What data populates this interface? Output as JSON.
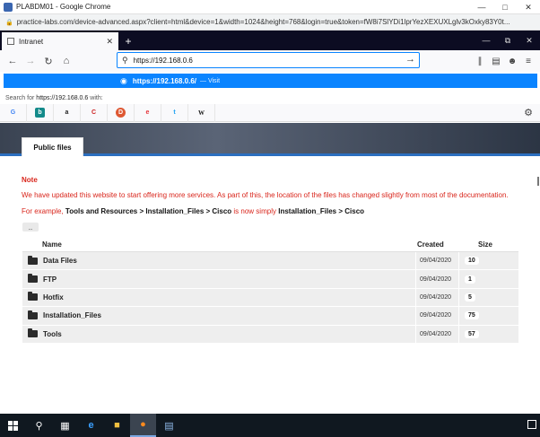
{
  "chrome": {
    "title": "PLABDM01 - Google Chrome",
    "url": "practice-labs.com/device-advanced.aspx?client=html&device=1&width=1024&height=768&login=true&token=fW8i7SlYDi1lprYezXEXUXLglv3kOxky83Y0t..."
  },
  "firefox": {
    "tab_label": "Intranet",
    "url_input": "https://192.168.0.6",
    "suggestion": {
      "url": "https://192.168.0.6/",
      "visit": "— Visit"
    },
    "search_with": {
      "prefix": "Search for",
      "query": "https://192.168.0.6",
      "suffix": "with:"
    },
    "engines": [
      {
        "name": "google-icon",
        "glyph": "G",
        "color": "#4285f4"
      },
      {
        "name": "bing-icon",
        "glyph": "b",
        "color": "#138a8a"
      },
      {
        "name": "amazon-icon",
        "glyph": "a",
        "color": "#222222"
      },
      {
        "name": "duckduckgo-icon",
        "glyph": "C",
        "color": "#cc2222"
      },
      {
        "name": "duckduckgo-orange-icon",
        "glyph": "D",
        "color": "#de5833"
      },
      {
        "name": "ebay-icon",
        "glyph": "e",
        "color": "#e53238"
      },
      {
        "name": "twitter-icon",
        "glyph": "t",
        "color": "#1da1f2"
      },
      {
        "name": "wikipedia-icon",
        "glyph": "W",
        "color": "#222222"
      }
    ]
  },
  "page": {
    "tab_label": "Public files",
    "note_title": "Note",
    "note_text": "We have updated this website to start offering more services. As part of this, the location of the files has changed slightly from most of the documentation.",
    "example_prefix": "For example,",
    "example_old": "Tools and Resources > Installation_Files > Cisco",
    "example_mid": "is now simply",
    "example_new": "Installation_Files > Cisco",
    "up_label": "..",
    "columns": {
      "name": "Name",
      "created": "Created",
      "size": "Size"
    },
    "rows": [
      {
        "name": "Data Files",
        "created": "09/04/2020",
        "size": "10"
      },
      {
        "name": "FTP",
        "created": "09/04/2020",
        "size": "1"
      },
      {
        "name": "Hotfix",
        "created": "09/04/2020",
        "size": "5"
      },
      {
        "name": "Installation_Files",
        "created": "09/04/2020",
        "size": "75"
      },
      {
        "name": "Tools",
        "created": "09/04/2020",
        "size": "57"
      }
    ]
  }
}
